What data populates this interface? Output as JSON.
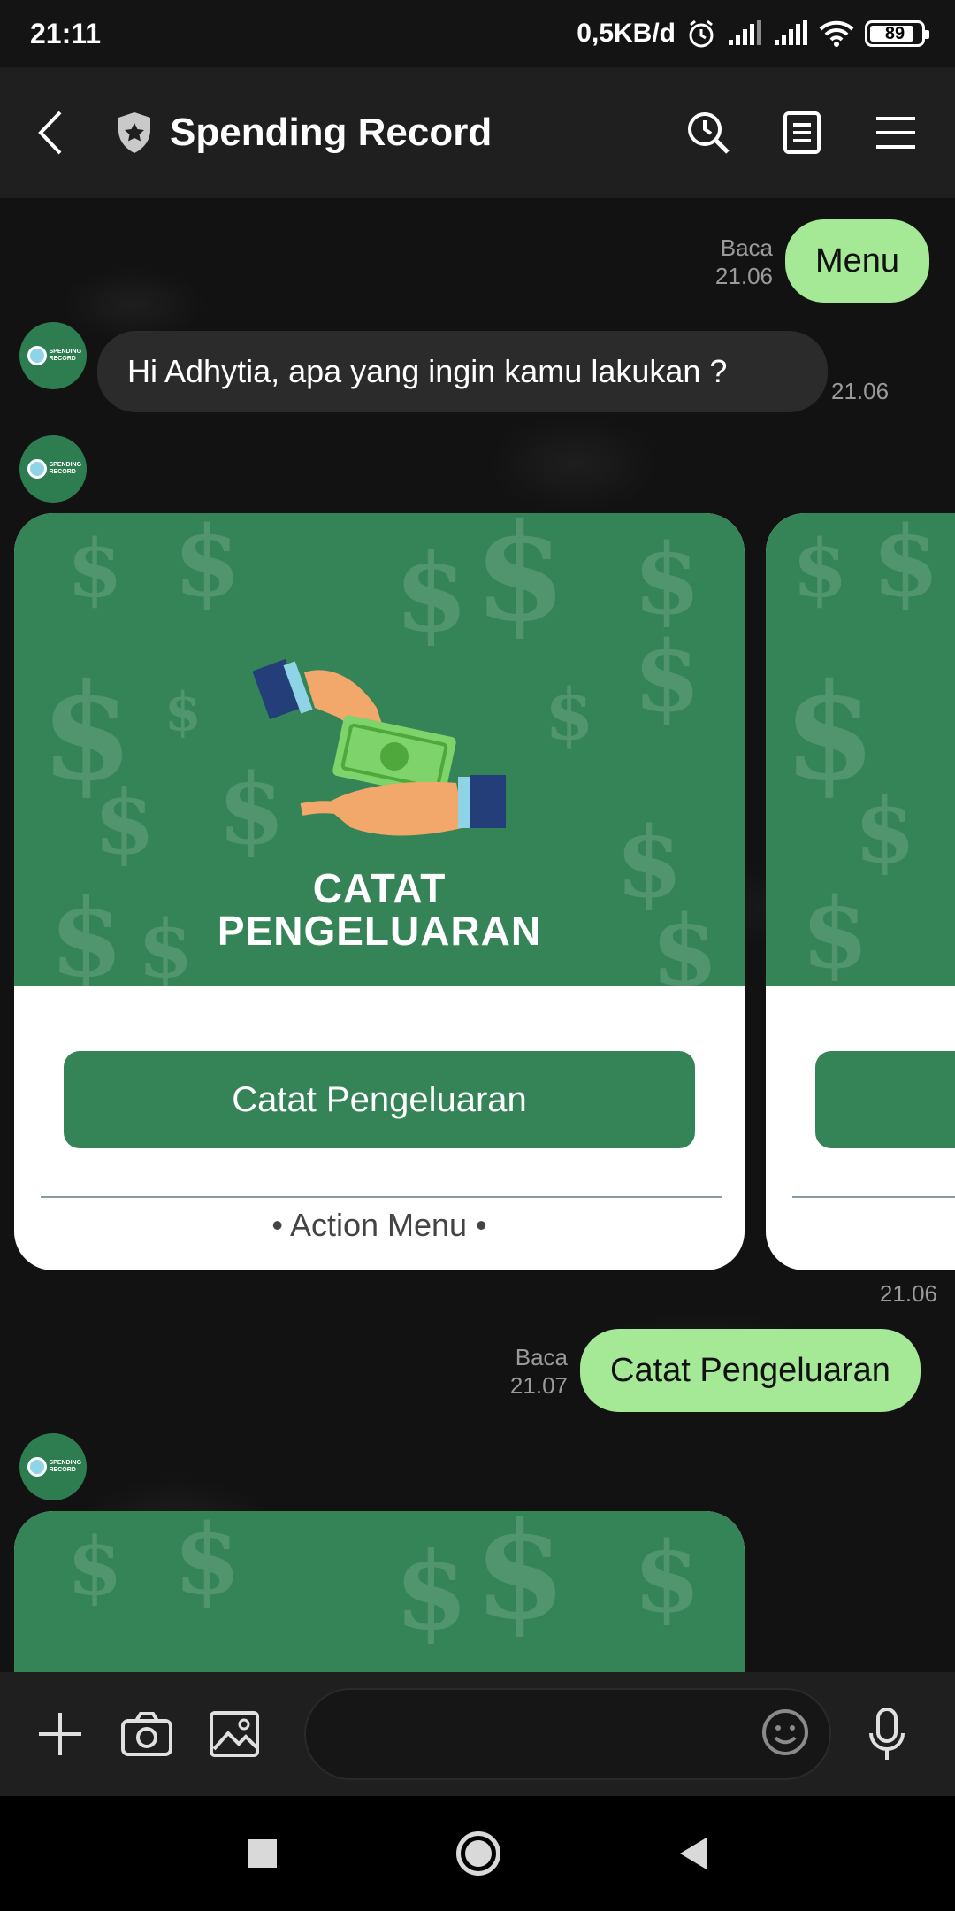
{
  "status_bar": {
    "time": "21:11",
    "network_speed": "0,5KB/d",
    "battery_percent": 89,
    "battery_label": "89"
  },
  "header": {
    "title": "Spending Record",
    "icons": [
      "back-arrow-icon",
      "shield-star-icon",
      "search-history-icon",
      "note-icon",
      "menu-icon"
    ]
  },
  "chat": {
    "messages": [
      {
        "side": "right",
        "text": "Menu",
        "status": "Baca",
        "time": "21.06"
      },
      {
        "side": "left",
        "text": "Hi Adhytia, apa yang ingin kamu lakukan ?",
        "time": "21.06"
      },
      {
        "side": "left",
        "type": "card",
        "image_caption_line1": "CATAT",
        "image_caption_line2": "PENGELUARAN",
        "button_label": "Catat Pengeluaran",
        "footer": "• Action Menu •",
        "time": "21.06"
      },
      {
        "side": "right",
        "text": "Catat Pengeluaran",
        "status": "Baca",
        "time": "21.07"
      }
    ],
    "avatar_text": "SPENDING RECORD"
  },
  "input_bar": {
    "placeholder": "",
    "icons": [
      "plus-icon",
      "camera-icon",
      "image-icon",
      "emoji-icon",
      "microphone-icon"
    ]
  },
  "colors": {
    "outgoing_bubble": "#a5e996",
    "incoming_bubble": "#2b2b2b",
    "card_green": "#358457",
    "header_bg": "#1f1f1f"
  }
}
